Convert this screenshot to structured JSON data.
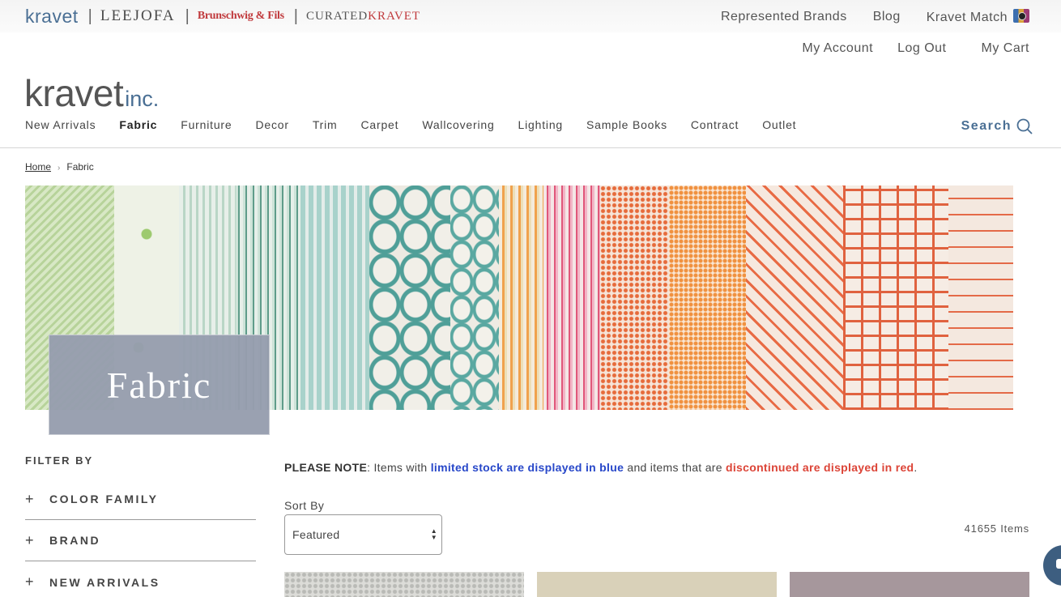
{
  "brands": {
    "kravet": "kravet",
    "leejofa": "LEEJOFA",
    "brunschwig": "Brunschwig & Fils",
    "curated_a": "CURATED",
    "curated_b": "KRAVET"
  },
  "top_links": {
    "represented_brands": "Represented Brands",
    "blog": "Blog",
    "kravet_match": "Kravet Match"
  },
  "account_links": {
    "my_account": "My Account",
    "log_out": "Log Out",
    "my_cart": "My Cart"
  },
  "logo": {
    "main": "kravet",
    "suffix": "inc."
  },
  "nav": [
    "New Arrivals",
    "Fabric",
    "Furniture",
    "Decor",
    "Trim",
    "Carpet",
    "Wallcovering",
    "Lighting",
    "Sample Books",
    "Contract",
    "Outlet"
  ],
  "nav_active": "Fabric",
  "search_label": "Search",
  "breadcrumb": {
    "home": "Home",
    "separator": "›",
    "current": "Fabric"
  },
  "hero": {
    "title": "Fabric"
  },
  "filter": {
    "heading": "FILTER BY",
    "items": [
      "COLOR FAMILY",
      "BRAND",
      "NEW ARRIVALS"
    ],
    "expand_symbol": "+"
  },
  "note": {
    "prefix": "PLEASE NOTE",
    "colon": ":",
    "text1": " Items with ",
    "blue": "limited stock are displayed in blue",
    "text2": " and items that are ",
    "red": "discontinued are displayed in red",
    "text3": "."
  },
  "sort": {
    "label": "Sort By",
    "selected": "Featured"
  },
  "item_count": "41655 Items",
  "colors": {
    "brand_blue": "#4a6f94",
    "limited_stock_blue": "#2747c9",
    "discontinued_red": "#dc4437",
    "hero_title_bg": "#969dae"
  }
}
